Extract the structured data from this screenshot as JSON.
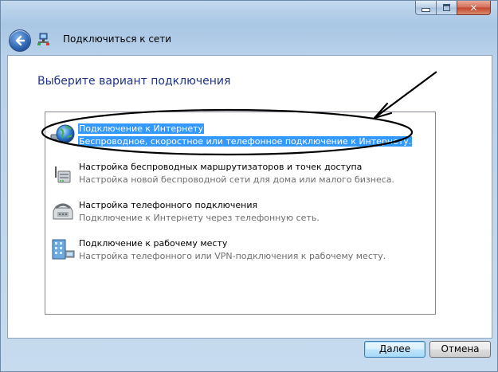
{
  "window": {
    "title": "Подключиться к сети"
  },
  "main": {
    "heading": "Выберите вариант подключения",
    "options": [
      {
        "title": "Подключение к Интернету",
        "description": "Беспроводное, скоростное или телефонное подключение к Интернету.",
        "icon": "globe-network-icon",
        "selected": true
      },
      {
        "title": "Настройка беспроводных маршрутизаторов и точек доступа",
        "description": "Настройка новой беспроводной сети для дома или малого бизнеса.",
        "icon": "wireless-router-icon",
        "selected": false
      },
      {
        "title": "Настройка телефонного подключения",
        "description": "Подключение к Интернету через телефонную сеть.",
        "icon": "dialup-modem-icon",
        "selected": false
      },
      {
        "title": "Подключение к рабочему месту",
        "description": "Настройка телефонного или VPN-подключения к рабочему месту.",
        "icon": "workplace-network-icon",
        "selected": false
      }
    ]
  },
  "buttons": {
    "next": "Далее",
    "cancel": "Отмена"
  },
  "colors": {
    "selection": "#3399ff",
    "heading": "#1e3287",
    "annotation": "#000000"
  }
}
